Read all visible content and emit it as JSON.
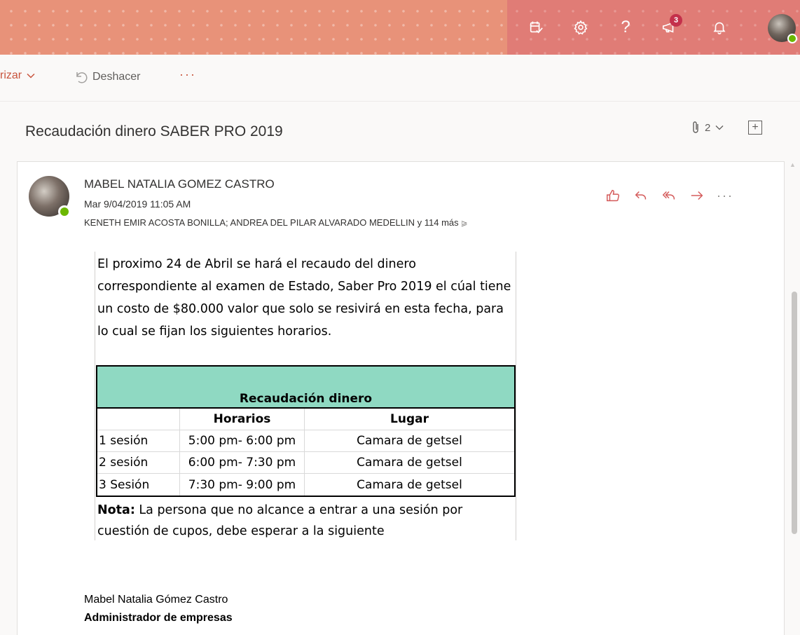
{
  "header": {
    "icons": [
      "my-day-icon",
      "settings-icon",
      "help-icon",
      "megaphone-icon",
      "bell-icon",
      "avatar"
    ],
    "help_glyph": "?",
    "megaphone_badge": "3"
  },
  "commandbar": {
    "prioritize_label": "rizar",
    "undo_label": "Deshacer",
    "more_label": "···"
  },
  "message": {
    "subject": "Recaudación dinero SABER PRO 2019",
    "attachment_count": "2",
    "sender": "MABEL NATALIA GOMEZ CASTRO",
    "date": "Mar 9/04/2019 11:05 AM",
    "recipients": "KENETH EMIR ACOSTA BONILLA; ANDREA DEL PILAR ALVARADO MEDELLIN",
    "recipients_more": "y 114 más",
    "more_actions": "···"
  },
  "body": {
    "paragraph": "El proximo 24 de Abril se hará el recaudo del dinero correspondiente al examen de Estado, Saber Pro 2019 el cúal tiene un costo de $80.000 valor que solo se resivirá en esta fecha, para lo cual se fijan los siguientes horarios.",
    "table": {
      "title": "Recaudación dinero",
      "headers": [
        "",
        "Horarios",
        "Lugar"
      ],
      "rows": [
        [
          "1 sesión",
          "5:00 pm- 6:00 pm",
          "Camara de getsel"
        ],
        [
          "2 sesión",
          "6:00 pm- 7:30 pm",
          "Camara de getsel"
        ],
        [
          "3 Sesión",
          "7:30 pm- 9:00 pm",
          "Camara de getsel"
        ]
      ]
    },
    "note_label": "Nota:",
    "note_text": " La persona que no alcance a entrar a una sesión por cuestión de cupos, debe esperar a la siguiente"
  },
  "signature": {
    "name": "Mabel Natalia Gómez Castro",
    "role": "Administrador de empresas"
  },
  "colors": {
    "header_left": "#e89279",
    "header_right": "#e07c76",
    "accent": "#d45a5a",
    "table_header": "#8fd9c2",
    "presence": "#6bb700"
  }
}
